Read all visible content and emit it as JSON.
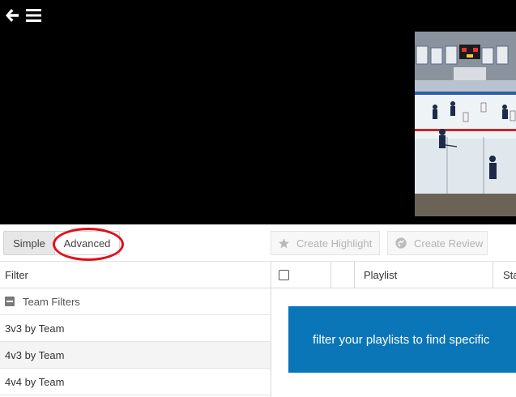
{
  "toolbar": {
    "simple_label": "Simple",
    "advanced_label": "Advanced",
    "create_highlight_label": "Create Highlight",
    "create_review_label": "Create Review"
  },
  "filter_panel": {
    "header": "Filter",
    "group_label": "Team Filters",
    "items": [
      "3v3 by Team",
      "4v3 by Team",
      "4v4 by Team"
    ]
  },
  "playlist_panel": {
    "columns": {
      "playlist": "Playlist",
      "status": "Sta"
    },
    "banner_text": "filter your playlists to find specific"
  },
  "colors": {
    "accent_blue": "#0a76b8",
    "annotation_red": "#e0101a",
    "video_background": "#000000"
  },
  "icons": {
    "back": "arrow-left-icon",
    "menu": "hamburger-menu-icon",
    "highlight": "star-icon",
    "review": "review-icon"
  }
}
